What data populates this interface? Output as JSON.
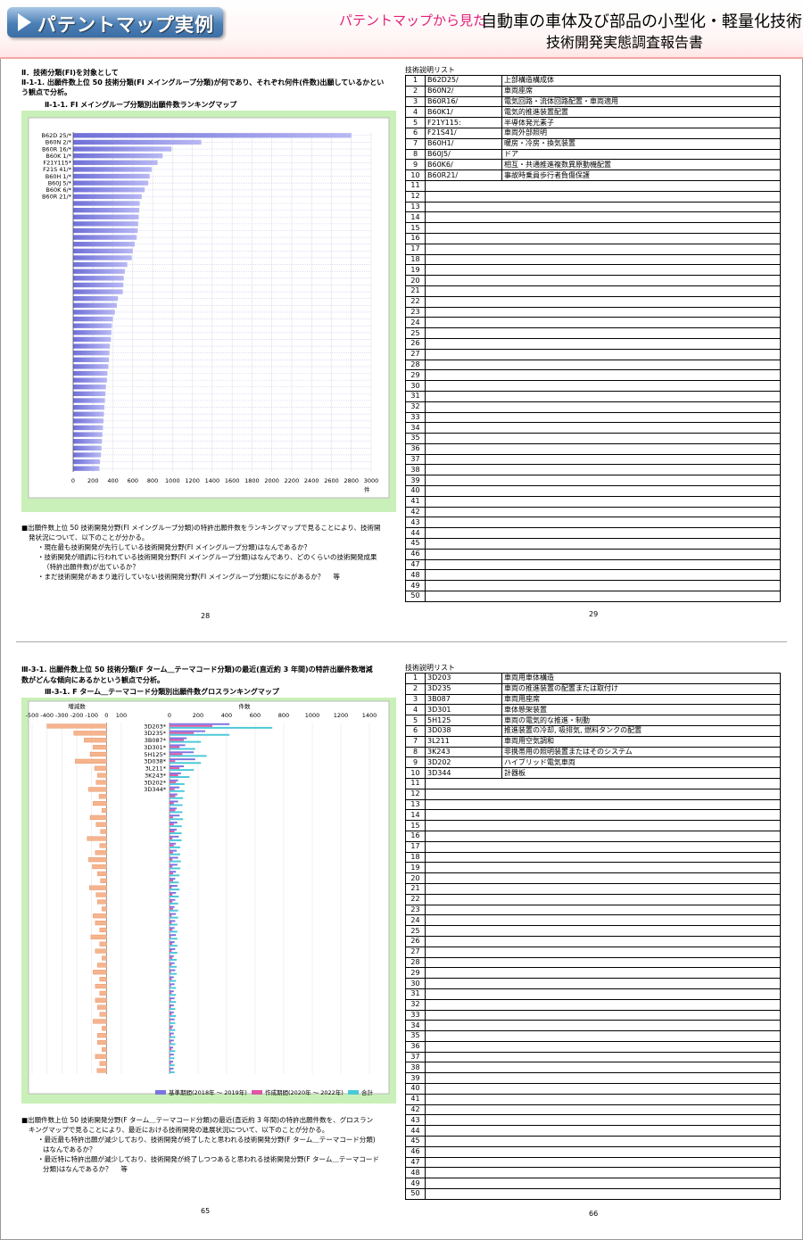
{
  "header": {
    "badge": "パテントマップ実例",
    "sub": "パテントマップから見た",
    "title1": "自動車の車体及び部品の小型化・軽量化技術",
    "title2": "技術開発実態調査報告書"
  },
  "top": {
    "heading1": "Ⅱ．技術分類(FI)を対象として",
    "heading2": "Ⅱ-1-1. 出願件数上位 50 技術分類(FI メイングループ分類)が何であり、それぞれ何件(件数)出願しているかとい",
    "heading3": "う観点で分析。",
    "chart_title": "Ⅱ-1-1. FI メイングループ分類別出願件数ランキングマップ",
    "notes": [
      "■出願件数上位 50 技術開発分野(FI メイングループ分類)の特許出願件数をランキングマップで見ることにより、技術開",
      "発状況について、以下のことが分かる。",
      "・現在最も技術開発が先行している技術開発分野(FI メイングループ分類)はなんであるか？",
      "・技術開発が順調に行われている技術開発分野(FI メイングループ分類)はなんであり、どのくらいの技術開発成果",
      "（特許出願件数)が出ているか？",
      "・まだ技術開発があまり進行していない技術開発分野(FI メイングループ分類)になにがあるか？　 等"
    ],
    "page_left": "28",
    "page_right": "29",
    "table_title": "技術説明リスト",
    "rows": [
      {
        "n": "1",
        "code": "B62D25/",
        "desc": "上部構造構成体"
      },
      {
        "n": "2",
        "code": "B60N2/",
        "desc": "車両座席"
      },
      {
        "n": "3",
        "code": "B60R16/",
        "desc": "電気回路・流体回路配置・車両適用"
      },
      {
        "n": "4",
        "code": "B60K1/",
        "desc": "電気的推進装置配置"
      },
      {
        "n": "5",
        "code": "F21Y115:",
        "desc": "半導体発光素子"
      },
      {
        "n": "6",
        "code": "F21S41/",
        "desc": "車両外部照明"
      },
      {
        "n": "7",
        "code": "B60H1/",
        "desc": "暖房・冷房・換気装置"
      },
      {
        "n": "8",
        "code": "B60J5/",
        "desc": "ドア"
      },
      {
        "n": "9",
        "code": "B60K6/",
        "desc": "相互・共通推進複数異原動機配置"
      },
      {
        "n": "10",
        "code": "B60R21/",
        "desc": "事故時乗員歩行者負傷保護"
      }
    ]
  },
  "bottom": {
    "heading1": "Ⅲ-3-1. 出願件数上位 50 技術分類(F ターム＿テーマコード分類)の最近(直近約 3 年間)の特許出願件数増減",
    "heading2": "数がどんな傾向にあるかという観点で分析。",
    "chart_title": "Ⅲ-3-1. F ターム＿テーマコード分類別出願件数グロスランキングマップ",
    "notes": [
      "■出願件数上位 50 技術開発分野(F ターム＿テーマコード分類)の最近(直近約 3 年間)の特許出願件数を、グロスラン",
      "キングマップで見ることにより、最近における技術開発の進展状況について、以下のことが分かる。",
      "・最近最も特許出願が減少しており、技術開発が終了したと思われる技術開発分野(F ターム＿テーマコード分類)",
      "はなんであるか？",
      "・最近特に特許出願が減少しており、技術開発が終了しつつあると思われる技術開発分野(F ターム＿テーマコード",
      "分類)はなんであるか？　 等"
    ],
    "page_left": "65",
    "page_right": "66",
    "table_title": "技術説明リスト",
    "rows": [
      {
        "n": "1",
        "code": "3D203",
        "desc": "車両用車体構造"
      },
      {
        "n": "2",
        "code": "3D235",
        "desc": "車両の推進装置の配置または取付け"
      },
      {
        "n": "3",
        "code": "3B087",
        "desc": "車両用座席"
      },
      {
        "n": "4",
        "code": "3D301",
        "desc": "車体懸架装置"
      },
      {
        "n": "5",
        "code": "5H125",
        "desc": "車両の電気的な推進・制動"
      },
      {
        "n": "6",
        "code": "3D038",
        "desc": "推進装置の冷却, 吸排気, 燃料タンクの配置"
      },
      {
        "n": "7",
        "code": "3L211",
        "desc": "車両用空気調和"
      },
      {
        "n": "8",
        "code": "3K243",
        "desc": "非携帯用の照明装置またはそのシステム"
      },
      {
        "n": "9",
        "code": "3D202",
        "desc": "ハイブリッド電気車両"
      },
      {
        "n": "10",
        "code": "3D344",
        "desc": "計器板"
      }
    ]
  },
  "chart_data": [
    {
      "type": "bar",
      "orientation": "horizontal",
      "title": "Ⅱ-1-1. FI メイングループ分類別出願件数ランキングマップ",
      "xlabel": "件",
      "xlim": [
        0,
        3000
      ],
      "xticks": [
        "0",
        "200",
        "400",
        "600",
        "800",
        "1000",
        "1200",
        "1400",
        "1600",
        "1800",
        "2000",
        "2200",
        "2400",
        "2600",
        "2800",
        "3000"
      ],
      "categories": [
        "B62D 25/*",
        "B60N 2/*",
        "B60R 16/*",
        "B60K 1/*",
        "F21Y115*",
        "F21S 41/*",
        "B60H 1/*",
        "B60J 5/*",
        "B60K 6/*",
        "B60R 21/*",
        "",
        "",
        "",
        "",
        "",
        "",
        "",
        "",
        "",
        "",
        "",
        "",
        "",
        "",
        "",
        "",
        "",
        "",
        "",
        "",
        "",
        "",
        "",
        "",
        "",
        "",
        "",
        "",
        "",
        "",
        "",
        "",
        "",
        "",
        "",
        "",
        "",
        "",
        "",
        ""
      ],
      "values": [
        2800,
        1290,
        990,
        900,
        850,
        790,
        770,
        755,
        720,
        690,
        670,
        665,
        660,
        655,
        650,
        640,
        620,
        600,
        590,
        545,
        520,
        510,
        505,
        500,
        450,
        440,
        420,
        400,
        390,
        385,
        380,
        370,
        365,
        360,
        355,
        345,
        340,
        330,
        325,
        320,
        315,
        310,
        305,
        300,
        295,
        290,
        285,
        280,
        270,
        265
      ]
    },
    {
      "type": "bar",
      "orientation": "horizontal",
      "title": "Ⅲ-3-1. F ターム＿テーマコード分類別出願件数グロスランキングマップ",
      "left_axis_label": "増減数",
      "right_axis_label": "件数",
      "left_xlim": [
        -500,
        100
      ],
      "left_xticks": [
        "-500",
        "-400",
        "-300",
        "-200",
        "-100",
        "0",
        "100"
      ],
      "right_xlim": [
        0,
        1400
      ],
      "right_xticks": [
        "0",
        "200",
        "400",
        "600",
        "800",
        "1000",
        "1200",
        "1400"
      ],
      "legend": [
        "基準期間(2018年 ～ 2019年)",
        "作成期間(2020年 ～ 2022年)",
        "合計"
      ],
      "categories": [
        "3D203*",
        "3D235*",
        "3B087*",
        "3D301*",
        "5H125*",
        "3D038*",
        "3L211*",
        "3K243*",
        "3D202*",
        "3D344*",
        "",
        "",
        "",
        "",
        "",
        "",
        "",
        "",
        "",
        "",
        "",
        "",
        "",
        "",
        "",
        "",
        "",
        "",
        "",
        "",
        "",
        "",
        "",
        "",
        "",
        "",
        "",
        "",
        "",
        "",
        "",
        "",
        "",
        "",
        "",
        "",
        "",
        "",
        "",
        ""
      ],
      "series": [
        {
          "name": "基準期間(2018年 ～ 2019年)",
          "values": [
            420,
            250,
            120,
            110,
            170,
            180,
            100,
            80,
            60,
            70,
            55,
            60,
            50,
            70,
            55,
            50,
            65,
            45,
            50,
            60,
            55,
            45,
            40,
            55,
            45,
            40,
            35,
            45,
            40,
            35,
            45,
            35,
            40,
            30,
            35,
            40,
            30,
            35,
            30,
            35,
            30,
            30,
            35,
            25,
            30,
            30,
            25,
            30,
            25,
            28
          ]
        },
        {
          "name": "作成期間(2020年 ～ 2022年)",
          "values": [
            300,
            170,
            100,
            70,
            90,
            40,
            70,
            60,
            45,
            35,
            40,
            30,
            40,
            25,
            30,
            35,
            20,
            30,
            25,
            20,
            20,
            25,
            25,
            15,
            20,
            20,
            25,
            15,
            15,
            20,
            10,
            20,
            15,
            20,
            15,
            10,
            15,
            10,
            15,
            10,
            10,
            15,
            5,
            15,
            10,
            10,
            15,
            5,
            10,
            7
          ]
        },
        {
          "name": "合計",
          "values": [
            720,
            420,
            220,
            180,
            260,
            220,
            170,
            140,
            105,
            105,
            95,
            90,
            90,
            95,
            85,
            85,
            85,
            75,
            75,
            80,
            75,
            70,
            65,
            70,
            65,
            60,
            60,
            60,
            55,
            55,
            55,
            55,
            55,
            50,
            50,
            50,
            45,
            45,
            45,
            45,
            40,
            45,
            40,
            40,
            40,
            40,
            40,
            35,
            35,
            35
          ]
        },
        {
          "name": "増減数",
          "values": [
            -400,
            -220,
            -150,
            -90,
            -110,
            -210,
            -80,
            -60,
            -70,
            -120,
            -50,
            -90,
            -30,
            -110,
            -70,
            -40,
            -130,
            -45,
            -75,
            -120,
            -95,
            -60,
            -40,
            -115,
            -70,
            -60,
            -30,
            -90,
            -75,
            -45,
            -105,
            -45,
            -75,
            -30,
            -60,
            -90,
            -45,
            -75,
            -45,
            -75,
            -60,
            -45,
            -90,
            -30,
            -60,
            -60,
            -30,
            -75,
            -45,
            -63
          ]
        }
      ]
    }
  ]
}
